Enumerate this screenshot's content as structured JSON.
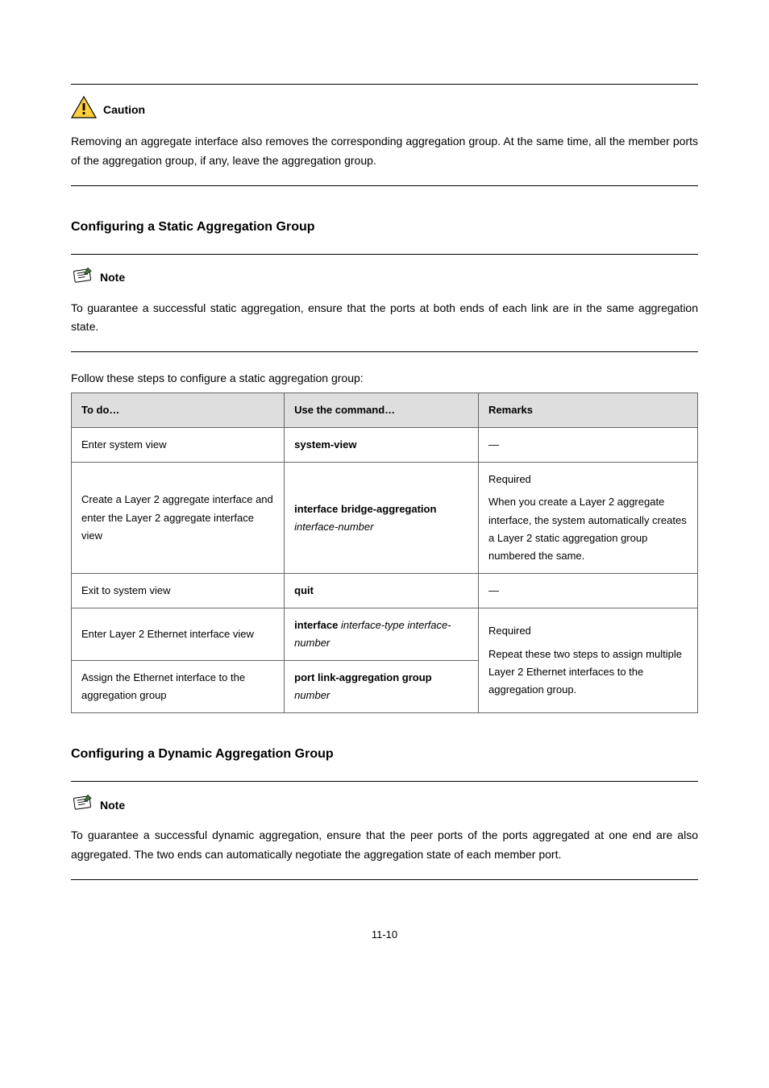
{
  "caution": {
    "label": "Caution",
    "body": "Removing an aggregate interface also removes the corresponding aggregation group. At the same time, all the member ports of the aggregation group, if any, leave the aggregation group."
  },
  "static": {
    "title": "Configuring a Static Aggregation Group",
    "note_label": "Note",
    "note_body": "To guarantee a successful static aggregation, ensure that the ports at both ends of each link are in the same aggregation state.",
    "intro": "Follow these steps to configure a static aggregation group:",
    "table": {
      "headers": [
        "To do…",
        "Use the command…",
        "Remarks"
      ],
      "rows": [
        {
          "todo": "Enter system view",
          "cmd_bold": "system-view",
          "cmd_arg": "",
          "remarks": "—"
        },
        {
          "todo": "Create a Layer 2 aggregate interface and enter the Layer 2 aggregate interface view",
          "cmd_bold": "interface bridge-aggregation",
          "cmd_arg": "interface-number",
          "remarks_line1": "Required",
          "remarks_line2": "When you create a Layer 2 aggregate interface, the system automatically creates a Layer 2 static aggregation group numbered the same."
        },
        {
          "todo": "Exit to system view",
          "cmd_bold": "quit",
          "cmd_arg": "",
          "remarks": "—"
        },
        {
          "todo": "Enter Layer 2 Ethernet interface view",
          "cmd_bold": "interface",
          "cmd_arg": "interface-type interface-number",
          "merged_remarks_line1": "Required",
          "merged_remarks_line2": "Repeat these two steps to assign multiple Layer 2 Ethernet interfaces to the aggregation group."
        },
        {
          "todo": "Assign the Ethernet interface to the aggregation group",
          "cmd_bold": "port link-aggregation group",
          "cmd_arg": "number"
        }
      ]
    }
  },
  "dynamic": {
    "title": "Configuring a Dynamic Aggregation Group",
    "note_label": "Note",
    "note_body": "To guarantee a successful dynamic aggregation, ensure that the peer ports of the ports aggregated at one end are also aggregated. The two ends can automatically negotiate the aggregation state of each member port."
  },
  "footer": "11-10"
}
